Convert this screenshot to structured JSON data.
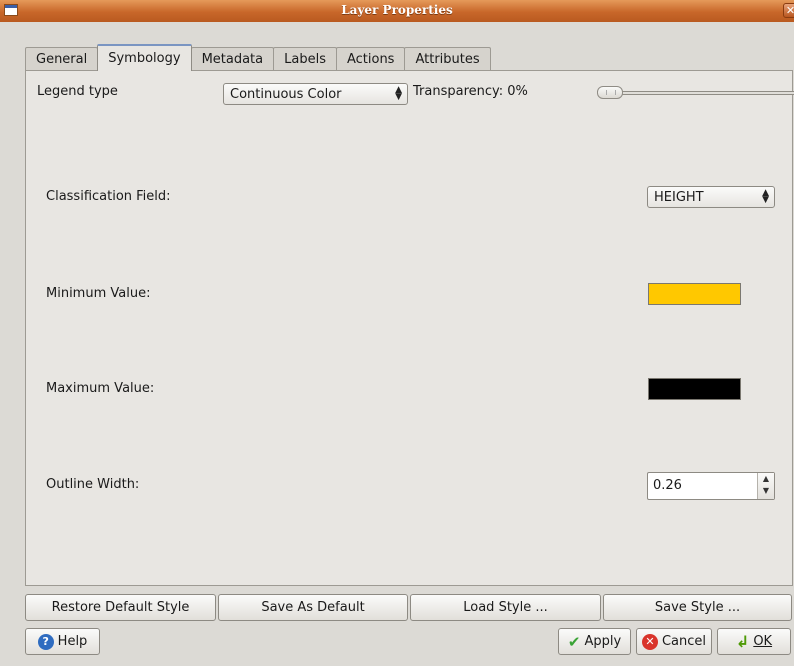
{
  "window": {
    "title": "Layer Properties"
  },
  "tabs": [
    {
      "label": "General"
    },
    {
      "label": "Symbology"
    },
    {
      "label": "Metadata"
    },
    {
      "label": "Labels"
    },
    {
      "label": "Actions"
    },
    {
      "label": "Attributes"
    }
  ],
  "symbology": {
    "legend_type_label": "Legend type",
    "legend_type_value": "Continuous Color",
    "transparency_label": "Transparency: 0%",
    "transparency_value": 0,
    "classification_label": "Classification Field:",
    "classification_value": "HEIGHT",
    "min_label": "Minimum Value:",
    "min_color": "#ffc800",
    "max_label": "Maximum Value:",
    "max_color": "#000000",
    "outline_label": "Outline Width:",
    "outline_value": "0.26"
  },
  "style_buttons": {
    "restore": "Restore Default Style",
    "save_default": "Save As Default",
    "load": "Load Style ...",
    "save": "Save Style ..."
  },
  "dialog_buttons": {
    "help": "Help",
    "apply": "Apply",
    "cancel": "Cancel",
    "ok": "OK"
  }
}
